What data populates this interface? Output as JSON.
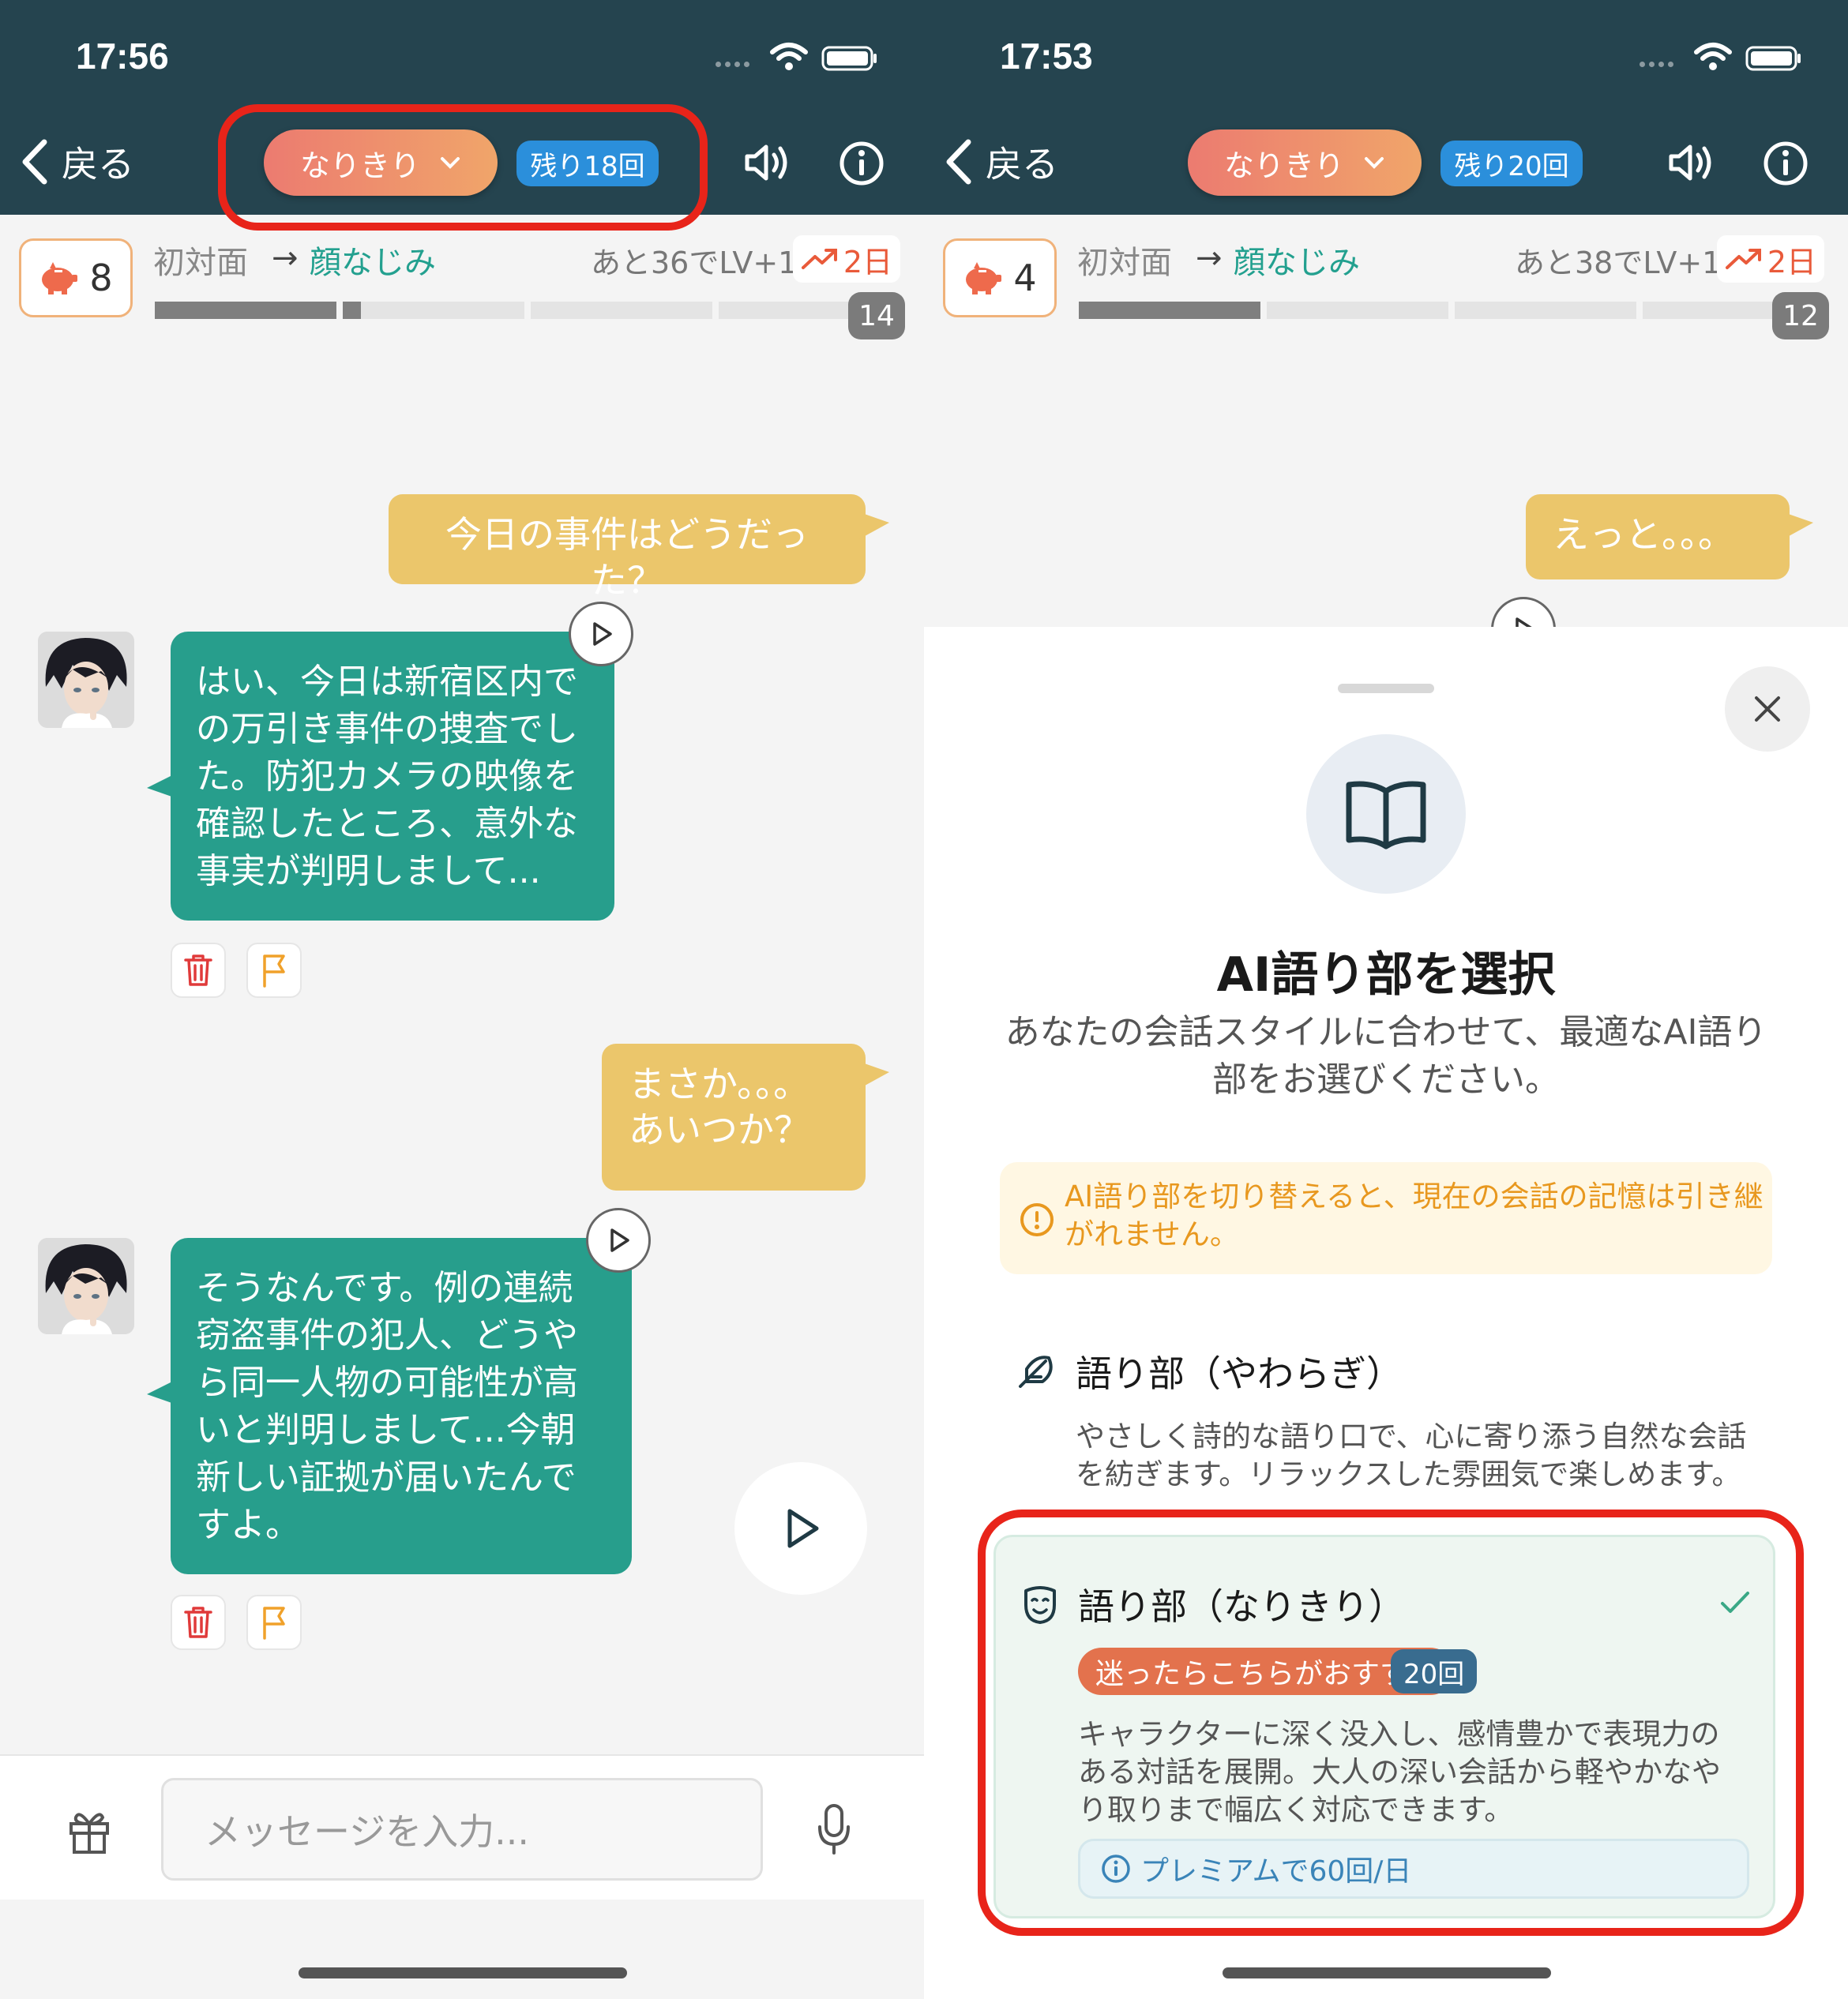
{
  "left": {
    "status": {
      "time": "17:56"
    },
    "header": {
      "back_label": "戻る",
      "mode_label": "なりきり",
      "remaining_label": "残り18回"
    },
    "level": {
      "coins": "8",
      "from": "初対面",
      "arrow": "→",
      "to": "顔なじみ",
      "next": "あと36でLV+1",
      "streak": "2日",
      "progress_count": "14",
      "progress_fill": [
        1.0,
        0.1,
        0.0,
        0.0
      ]
    },
    "messages": [
      {
        "role": "user",
        "text": "今日の事件はどうだった？"
      },
      {
        "role": "bot",
        "text": "はい、今日は新宿区内での万引き事件の捜査でした。防犯カメラの映像を確認したところ、意外な事実が判明しまして..."
      },
      {
        "role": "user",
        "text": "まさか。。。あいつか？"
      },
      {
        "role": "bot",
        "text": "そうなんです。例の連続窃盗事件の犯人、どうやら同一人物の可能性が高いと判明しまして...今朝新しい証拠が届いたんですよ。"
      }
    ],
    "input": {
      "placeholder": "メッセージを入力..."
    }
  },
  "right": {
    "status": {
      "time": "17:53"
    },
    "header": {
      "back_label": "戻る",
      "mode_label": "なりきり",
      "remaining_label": "残り20回"
    },
    "level": {
      "coins": "4",
      "from": "初対面",
      "arrow": "→",
      "to": "顔なじみ",
      "next": "あと38でLV+1",
      "streak": "2日",
      "progress_count": "12",
      "progress_fill": [
        1.0,
        0.0,
        0.0,
        0.0
      ]
    },
    "messages": [
      {
        "role": "user",
        "text": "えっと。。。"
      }
    ],
    "sheet": {
      "title": "AI語り部を選択",
      "subtitle": "あなたの会話スタイルに合わせて、最適なAI語り部をお選びください。",
      "warning": "AI語り部を切り替えると、現在の会話の記憶は引き継がれません。",
      "options": [
        {
          "title": "語り部（やわらぎ）",
          "description": "やさしく詩的な語り口で、心に寄り添う自然な会話を紡ぎます。リラックスした雰囲気で楽しめます。",
          "icon": "feather-icon"
        },
        {
          "title": "語り部（なりきり）",
          "badge": "迷ったらこちらがおすすめ",
          "count": "20回",
          "description": "キャラクターに深く没入し、感情豊かで表現力のある対話を展開。大人の深い会話から軽やかなやり取りまで幅広く対応できます。",
          "premium": "プレミアムで60回/日",
          "icon": "theater-mask-icon",
          "selected": true
        }
      ]
    }
  },
  "colors": {
    "header_bg": "#25444f",
    "user_bubble": "#ebc66b",
    "bot_bubble": "#279e8c",
    "highlight": "#e8241a",
    "remaining_pill": "#2b8fdb"
  }
}
